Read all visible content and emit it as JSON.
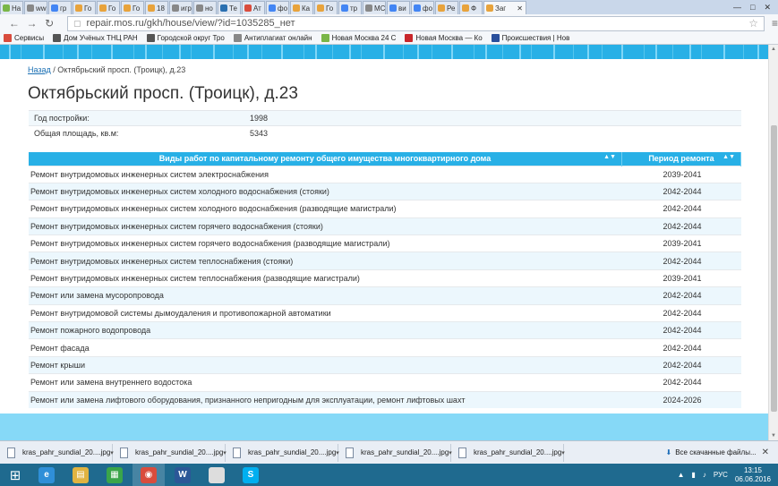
{
  "browser": {
    "tabs": [
      {
        "label": "На",
        "color": "#7ab648"
      },
      {
        "label": "ww",
        "color": "#888888"
      },
      {
        "label": "гр",
        "color": "#4285f4"
      },
      {
        "label": "Го",
        "color": "#e8a33c"
      },
      {
        "label": "Го",
        "color": "#e8a33c"
      },
      {
        "label": "Го",
        "color": "#e8a33c"
      },
      {
        "label": "18",
        "color": "#e8a33c"
      },
      {
        "label": "игр",
        "color": "#888888"
      },
      {
        "label": "но",
        "color": "#888888"
      },
      {
        "label": "Те",
        "color": "#2a6fb0"
      },
      {
        "label": "Ат",
        "color": "#d94c3d"
      },
      {
        "label": "фо",
        "color": "#4285f4"
      },
      {
        "label": "Ка",
        "color": "#e8a33c"
      },
      {
        "label": "Го",
        "color": "#e8a33c"
      },
      {
        "label": "тр",
        "color": "#4285f4"
      },
      {
        "label": "МС",
        "color": "#888888"
      },
      {
        "label": "ви",
        "color": "#4285f4"
      },
      {
        "label": "фо",
        "color": "#4285f4"
      },
      {
        "label": "Ре",
        "color": "#e8a33c"
      },
      {
        "label": "Ф",
        "color": "#e8a33c"
      }
    ],
    "active_tab": {
      "label": "Заг"
    },
    "url": "repair.mos.ru/gkh/house/view/?id=1035285_нет",
    "bookmarks": [
      {
        "label": "Сервисы",
        "color": "#d94c3d"
      },
      {
        "label": "Дом Учёных ТНЦ РАН",
        "color": "#555555"
      },
      {
        "label": "Городской округ Тро",
        "color": "#555555"
      },
      {
        "label": "Антиплагиат онлайн",
        "color": "#888888"
      },
      {
        "label": "Новая Москва 24 С",
        "color": "#7ab648"
      },
      {
        "label": "Новая Москва — Ко",
        "color": "#c8262b"
      },
      {
        "label": "Происшествия | Нов",
        "color": "#2a4f9c"
      }
    ]
  },
  "page": {
    "breadcrumb_back": "Назад",
    "breadcrumb_current": " / Октябрьский просп. (Троицк), д.23",
    "title": "Октябрьский просп. (Троицк), д.23",
    "info": [
      {
        "key": "Год постройки:",
        "value": "1998"
      },
      {
        "key": "Общая площадь, кв.м:",
        "value": "5343"
      }
    ],
    "table": {
      "col_works": "Виды работ по капитальному ремонту общего имущества многоквартирного дома",
      "col_period": "Период ремонта",
      "rows": [
        {
          "work": "Ремонт внутридомовых инженерных систем электроснабжения",
          "period": "2039-2041"
        },
        {
          "work": "Ремонт внутридомовых инженерных систем холодного водоснабжения (стояки)",
          "period": "2042-2044"
        },
        {
          "work": "Ремонт внутридомовых инженерных систем холодного водоснабжения (разводящие магистрали)",
          "period": "2042-2044"
        },
        {
          "work": "Ремонт внутридомовых инженерных систем горячего водоснабжения (стояки)",
          "period": "2042-2044"
        },
        {
          "work": "Ремонт внутридомовых инженерных систем горячего водоснабжения (разводящие магистрали)",
          "period": "2039-2041"
        },
        {
          "work": "Ремонт внутридомовых инженерных систем теплоснабжения (стояки)",
          "period": "2042-2044"
        },
        {
          "work": "Ремонт внутридомовых инженерных систем теплоснабжения (разводящие магистрали)",
          "period": "2039-2041"
        },
        {
          "work": "Ремонт или замена мусоропровода",
          "period": "2042-2044"
        },
        {
          "work": "Ремонт внутридомовой системы дымоудаления и противопожарной автоматики",
          "period": "2042-2044"
        },
        {
          "work": "Ремонт пожарного водопровода",
          "period": "2042-2044"
        },
        {
          "work": "Ремонт фасада",
          "period": "2042-2044"
        },
        {
          "work": "Ремонт крыши",
          "period": "2042-2044"
        },
        {
          "work": "Ремонт или замена внутреннего водостока",
          "period": "2042-2044"
        },
        {
          "work": "Ремонт или замена лифтового оборудования, признанного непригодным для эксплуатации, ремонт лифтовых шахт",
          "period": "2024-2026"
        }
      ]
    }
  },
  "downloads": {
    "items": [
      "kras_pahr_sundial_20....jpg",
      "kras_pahr_sundial_20....jpg",
      "kras_pahr_sundial_20....jpg",
      "kras_pahr_sundial_20....jpg",
      "kras_pahr_sundial_20....jpg"
    ],
    "show_all": "Все скачанные файлы..."
  },
  "taskbar": {
    "apps": [
      {
        "name": "ie",
        "glyph": "e",
        "color": "#2f8fd8"
      },
      {
        "name": "explorer",
        "glyph": "▤",
        "color": "#e0b341"
      },
      {
        "name": "store",
        "glyph": "▦",
        "color": "#3aa54a"
      },
      {
        "name": "chrome",
        "glyph": "◉",
        "color": "#d94c3d"
      },
      {
        "name": "word",
        "glyph": "W",
        "color": "#2b5797"
      },
      {
        "name": "blank",
        "glyph": "",
        "color": "#dddddd"
      },
      {
        "name": "skype",
        "glyph": "S",
        "color": "#00aff0"
      }
    ],
    "lang": "РУС",
    "time": "13:15",
    "date": "06.06.2016"
  }
}
